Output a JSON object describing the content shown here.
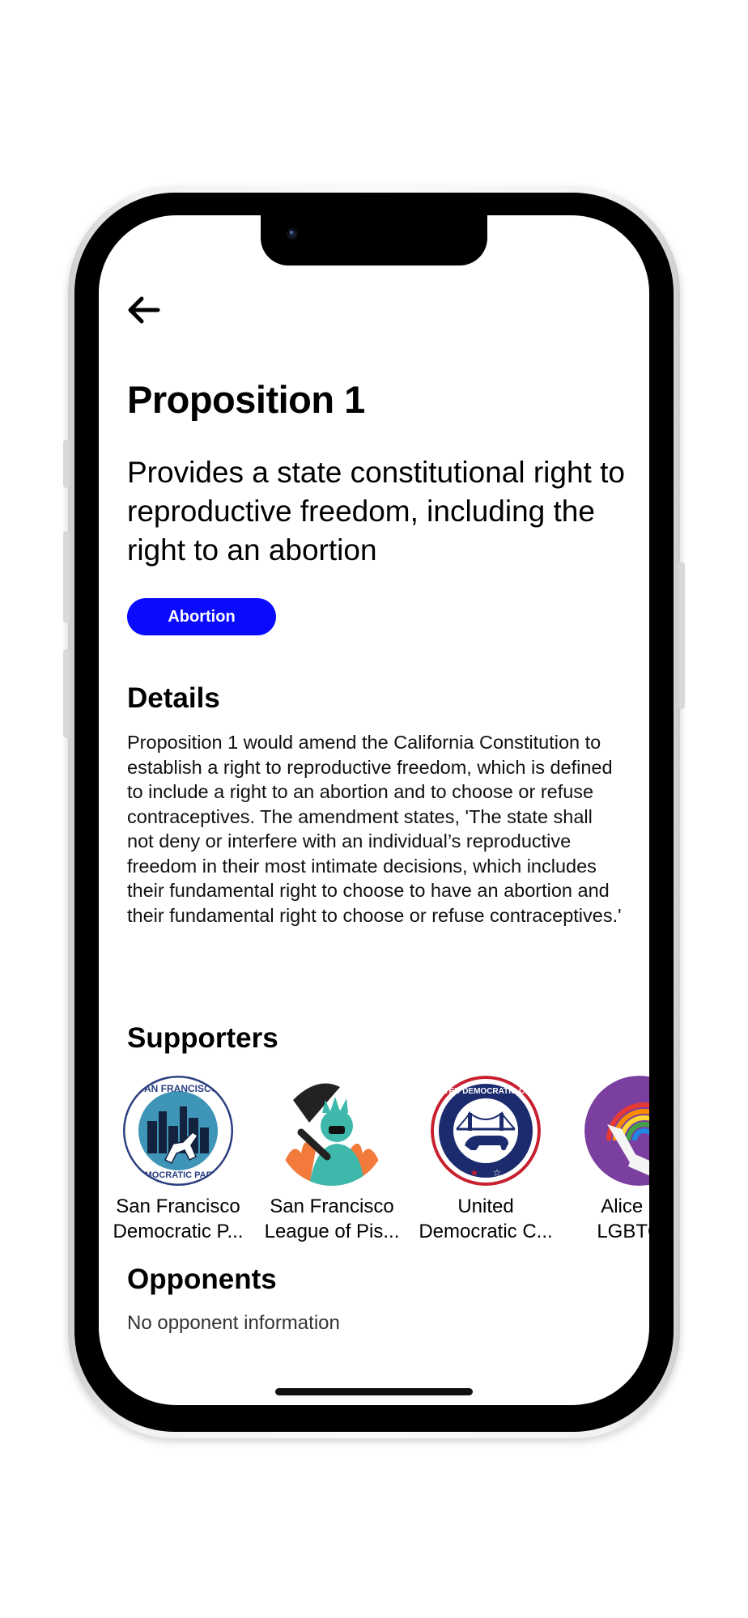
{
  "nav": {
    "back_icon": "arrow-left-icon"
  },
  "proposition": {
    "title": "Proposition 1",
    "summary": "Provides a state constitutional right to reproductive freedom, including the right to an abortion",
    "tag": "Abortion",
    "tag_color": "#0A0AFF"
  },
  "details": {
    "heading": "Details",
    "body": "Proposition 1 would amend the California Constitution to establish a right to reproductive freedom, which is defined to include a right to an abortion and to choose or refuse contraceptives. The amendment states, 'The state shall not deny or interfere with an individual’s reproductive freedom in their most intimate decisions, which includes their fundamental right to choose to have an abortion and their fundamental right to choose or refuse contraceptives.'"
  },
  "supporters": {
    "heading": "Supporters",
    "items": [
      {
        "line1": "San Francisco",
        "line2": "Democratic P...",
        "logo": "sf-democratic-party-logo"
      },
      {
        "line1": "San Francisco",
        "line2": "League of Pis...",
        "logo": "statue-of-liberty-logo"
      },
      {
        "line1": "United",
        "line2": "Democratic C...",
        "logo": "united-democratic-club-logo"
      },
      {
        "line1": "Alice B T",
        "line2": "LGBTQ D",
        "logo": "torch-rainbow-logo"
      }
    ]
  },
  "opponents": {
    "heading": "Opponents",
    "empty_text": "No opponent information"
  }
}
